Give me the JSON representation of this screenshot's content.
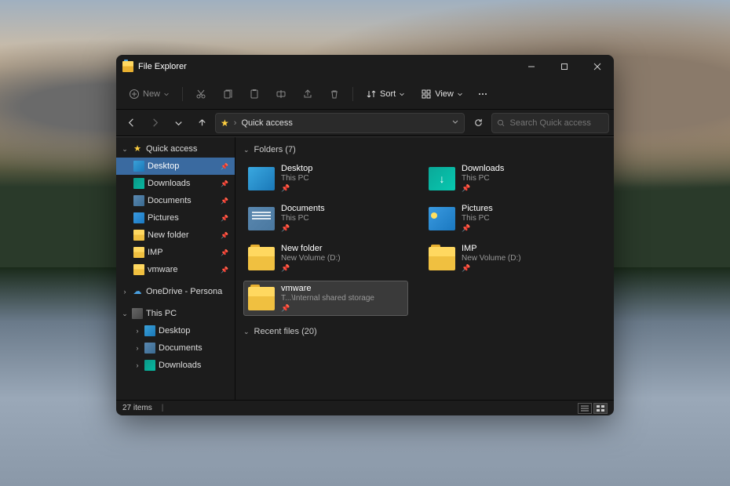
{
  "window": {
    "title": "File Explorer"
  },
  "toolbar": {
    "new": "New",
    "sort": "Sort",
    "view": "View"
  },
  "address": {
    "location": "Quick access"
  },
  "search": {
    "placeholder": "Search Quick access"
  },
  "sidebar": {
    "quick_access": "Quick access",
    "items": [
      {
        "label": "Desktop"
      },
      {
        "label": "Downloads"
      },
      {
        "label": "Documents"
      },
      {
        "label": "Pictures"
      },
      {
        "label": "New folder"
      },
      {
        "label": "IMP"
      },
      {
        "label": "vmware"
      }
    ],
    "onedrive": "OneDrive - Persona",
    "this_pc": "This PC",
    "pc_items": [
      {
        "label": "Desktop"
      },
      {
        "label": "Documents"
      },
      {
        "label": "Downloads"
      }
    ]
  },
  "sections": {
    "folders": "Folders (7)",
    "recent": "Recent files (20)"
  },
  "folders": [
    {
      "name": "Desktop",
      "sub": "This PC",
      "icon": "desktop"
    },
    {
      "name": "Downloads",
      "sub": "This PC",
      "icon": "down"
    },
    {
      "name": "Documents",
      "sub": "This PC",
      "icon": "doc"
    },
    {
      "name": "Pictures",
      "sub": "This PC",
      "icon": "pic"
    },
    {
      "name": "New folder",
      "sub": "New Volume (D:)",
      "icon": "folder"
    },
    {
      "name": "IMP",
      "sub": "New Volume (D:)",
      "icon": "folder"
    },
    {
      "name": "vmware",
      "sub": "T...\\Internal shared storage",
      "icon": "folder",
      "selected": true
    }
  ],
  "status": {
    "items": "27 items"
  }
}
